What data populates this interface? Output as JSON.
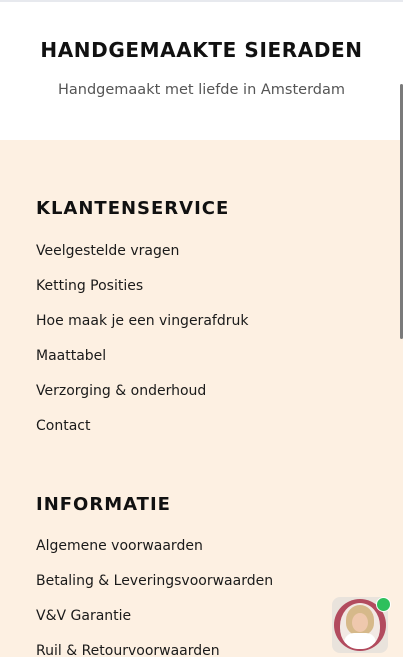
{
  "header": {
    "brand": "HANDGEMAAKTE SIERADEN",
    "tagline": "Handgemaakt met liefde in Amsterdam"
  },
  "footer": {
    "sections": [
      {
        "title": "KLANTENSERVICE",
        "links": [
          "Veelgestelde vragen",
          "Ketting Posities",
          "Hoe maak je een vingerafdruk",
          "Maattabel",
          "Verzorging & onderhoud",
          "Contact"
        ]
      },
      {
        "title": "INFORMATIE",
        "links": [
          "Algemene voorwaarden",
          "Betaling & Leveringsvoorwaarden",
          "V&V Garantie",
          "Ruil & Retourvoorwaarden"
        ]
      }
    ]
  },
  "chat_widget": {
    "status_color": "#2ec05c"
  },
  "colors": {
    "footer_background": "#fdf0e2",
    "header_background": "#ffffff"
  }
}
